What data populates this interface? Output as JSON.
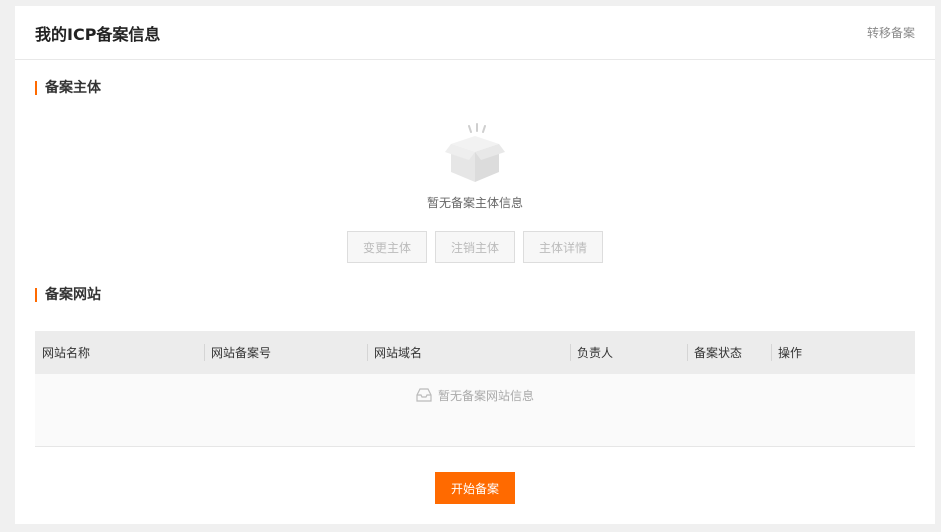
{
  "header": {
    "title": "我的ICP备案信息",
    "transfer_link": "转移备案"
  },
  "subject_section": {
    "title": "备案主体",
    "empty_icon": "open-box-icon",
    "empty_text": "暂无备案主体信息",
    "buttons": [
      "变更主体",
      "注销主体",
      "主体详情"
    ]
  },
  "website_section": {
    "title": "备案网站",
    "columns": [
      "网站名称",
      "网站备案号",
      "网站域名",
      "负责人",
      "备案状态",
      "操作"
    ],
    "empty_icon": "inbox-tray-icon",
    "empty_text": "暂无备案网站信息"
  },
  "actions": {
    "start_button": "开始备案"
  },
  "colors": {
    "accent": "#ff6a00",
    "table_header_bg": "#ececec"
  }
}
